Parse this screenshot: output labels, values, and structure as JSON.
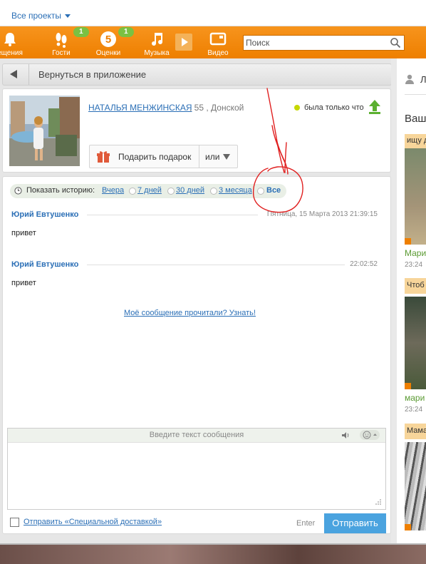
{
  "top_bar": {
    "projects_label": "Все проекты"
  },
  "toolbar": {
    "items": [
      {
        "label": "ещения",
        "icon": "bell-icon"
      },
      {
        "label": "Гости",
        "icon": "footprints-icon",
        "badge": "1"
      },
      {
        "label": "Оценки",
        "icon": "five-rating-icon",
        "badge": "1"
      },
      {
        "label": "Музыка",
        "icon": "music-note-icon"
      },
      {
        "label": "Видео",
        "icon": "video-icon"
      }
    ],
    "search_placeholder": "Поиск"
  },
  "back_bar": {
    "label": "Вернуться в приложение"
  },
  "profile": {
    "name": "НАТАЛЬЯ МЕНЖИНСКАЯ",
    "info": ", 55 , Донской",
    "status": "была только что",
    "gift_label": "Подарить подарок",
    "or_label": "или"
  },
  "history": {
    "label": "Показать историю:",
    "options": [
      "Вчера",
      "7 дней",
      "30 дней",
      "3 месяца",
      "Все"
    ],
    "selected": "Все"
  },
  "messages": [
    {
      "author": "Юрий Евтушенко",
      "time": "Пятница, 15 Марта 2013 21:39:15",
      "text": "привет"
    },
    {
      "author": "Юрий Евтушенко",
      "time": "22:02:52",
      "text": "привет"
    }
  ],
  "read_link": "Моё сообщение прочитали? Узнать!",
  "compose": {
    "placeholder": "Введите текст сообщения"
  },
  "footer": {
    "special_delivery": "Отправить «Специальной доставкой»",
    "enter_label": "Enter",
    "send_label": "Отправить"
  },
  "right_column": {
    "top_label": "Л",
    "heading": "Ваш",
    "cards": [
      {
        "caption": "ищу д",
        "name": "Мари",
        "time": "23:24"
      },
      {
        "caption": "Чтоб",
        "name": "мари",
        "time": "23:24"
      },
      {
        "caption": "Мама",
        "name": "",
        "time": ""
      }
    ]
  },
  "colors": {
    "accent": "#ee7f00",
    "link": "#2b6fb6",
    "badge": "#7ac142",
    "send": "#4aa3df",
    "annotation": "#e02020"
  }
}
